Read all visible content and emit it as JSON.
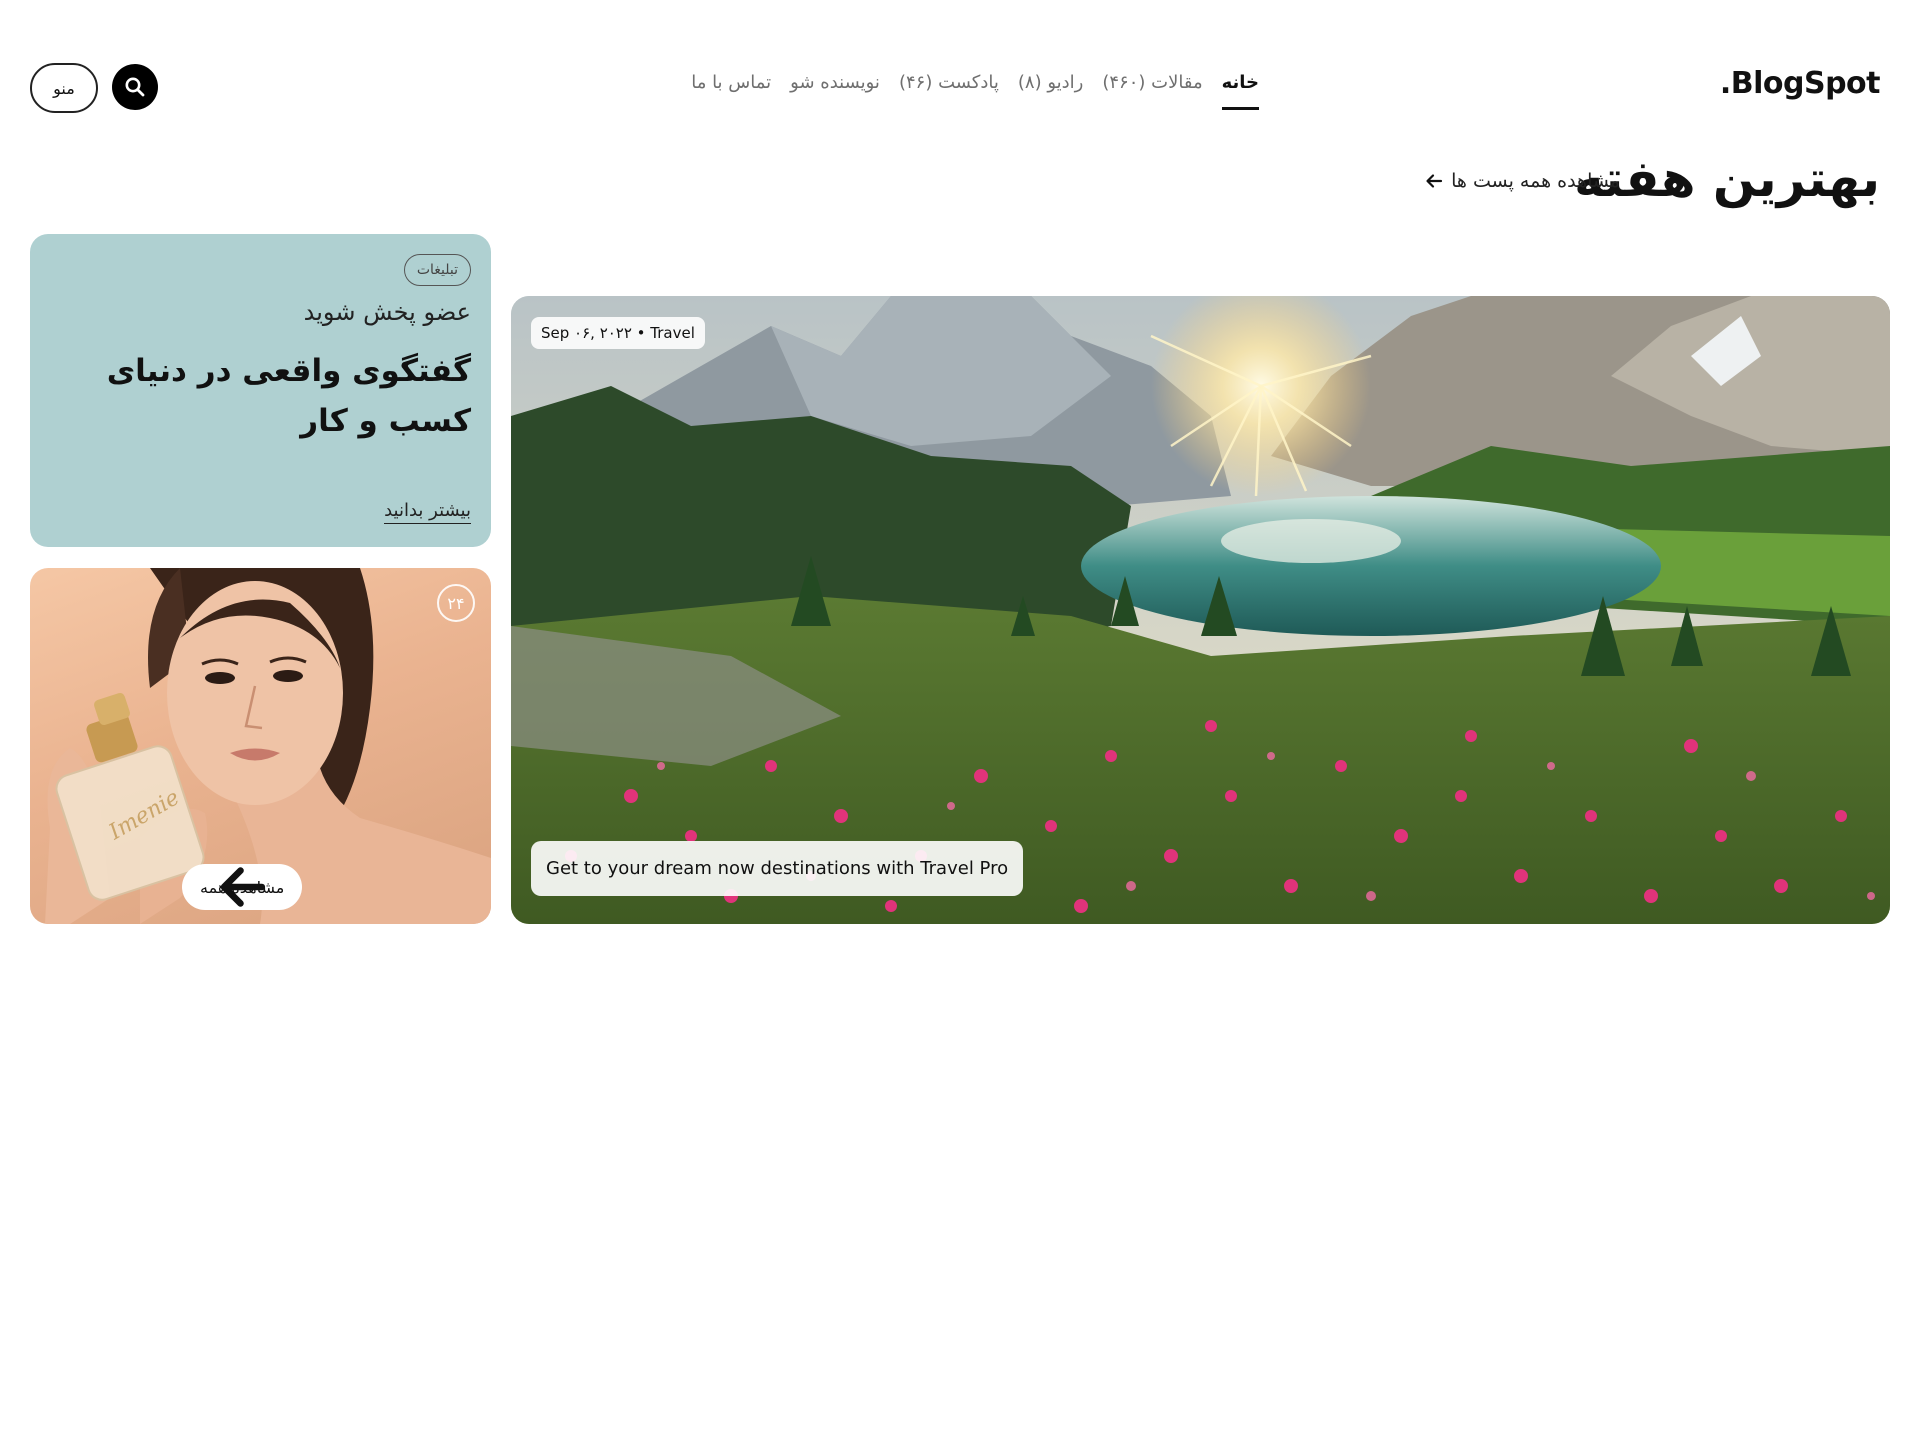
{
  "header": {
    "logo": ".BlogSpot",
    "nav": [
      {
        "label": "خانه",
        "active": true
      },
      {
        "label": "مقالات (۴۶۰)",
        "active": false
      },
      {
        "label": "رادیو (۸)",
        "active": false
      },
      {
        "label": "پادکست (۴۶)",
        "active": false
      },
      {
        "label": "نویسنده شو",
        "active": false
      },
      {
        "label": "تماس با ما",
        "active": false
      }
    ],
    "search_icon": "search-icon",
    "menu_label": "منو"
  },
  "section": {
    "title": "بهترین هفته",
    "see_all": "مشاهده همه پست ها",
    "see_all_icon": "arrow-left-icon"
  },
  "hero": {
    "meta": "Sep ۰۶, ۲۰۲۲ • Travel",
    "caption": "Get to your dream now destinations with Travel Pro"
  },
  "ad": {
    "badge": "تبلیغات",
    "subtitle": "عضو پخش شوید",
    "title": "گفتگوی واقعی در دنیای کسب و کار",
    "link": "بیشتر بدانید",
    "bg_color": "#afd0d1"
  },
  "product": {
    "count": "۲۴",
    "button": "مشاهده همه",
    "bottle_text": "Imenie",
    "button_icon": "arrow-left-icon"
  }
}
